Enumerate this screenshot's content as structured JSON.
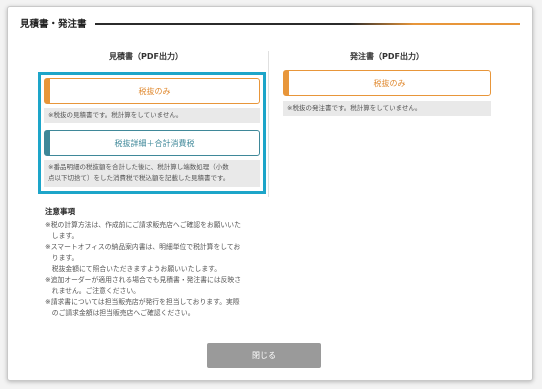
{
  "dialog": {
    "title": "見積書・発注書",
    "close_label": "閉じる"
  },
  "estimate": {
    "title": "見積書（PDF出力）",
    "btn_no_tax": "税抜のみ",
    "note_no_tax": "※税抜の見積書です。税計算をしていません。",
    "btn_tax_detail": "税抜詳細＋合計消費税",
    "note_tax_detail": [
      "※番品明細の税抜額を合計した後に、税計算し端数処理（小数",
      "点以下切捨て）をした消費税で税込額を記載した見積書です。"
    ]
  },
  "order": {
    "title": "発注書（PDF出力）",
    "btn_no_tax": "税抜のみ",
    "note_no_tax": "※税抜の発注書です。税計算をしていません。"
  },
  "notice": {
    "heading": "注意事項",
    "lines": [
      "※税の計算方法は、作成前にご請求販売店へご確認をお願いいた",
      "　します。",
      "※スマートオフィスの納品案内書は、明細単位で税計算をしてお",
      "　ります。",
      "　税抜金額にて照合いただきますようお願いいたします。",
      "※追加オーダーが適用される場合でも見積書・発注書には反映さ",
      "　れません。ご注意ください。",
      "※請求書については担当販売店が発行を担当しております。実際",
      "　のご請求金額は担当販売店へご確認ください。"
    ]
  },
  "colors": {
    "accent_orange": "#e8963a",
    "accent_teal": "#3f8899",
    "highlight": "#1da5c9",
    "close_button": "#9a9a9a"
  }
}
